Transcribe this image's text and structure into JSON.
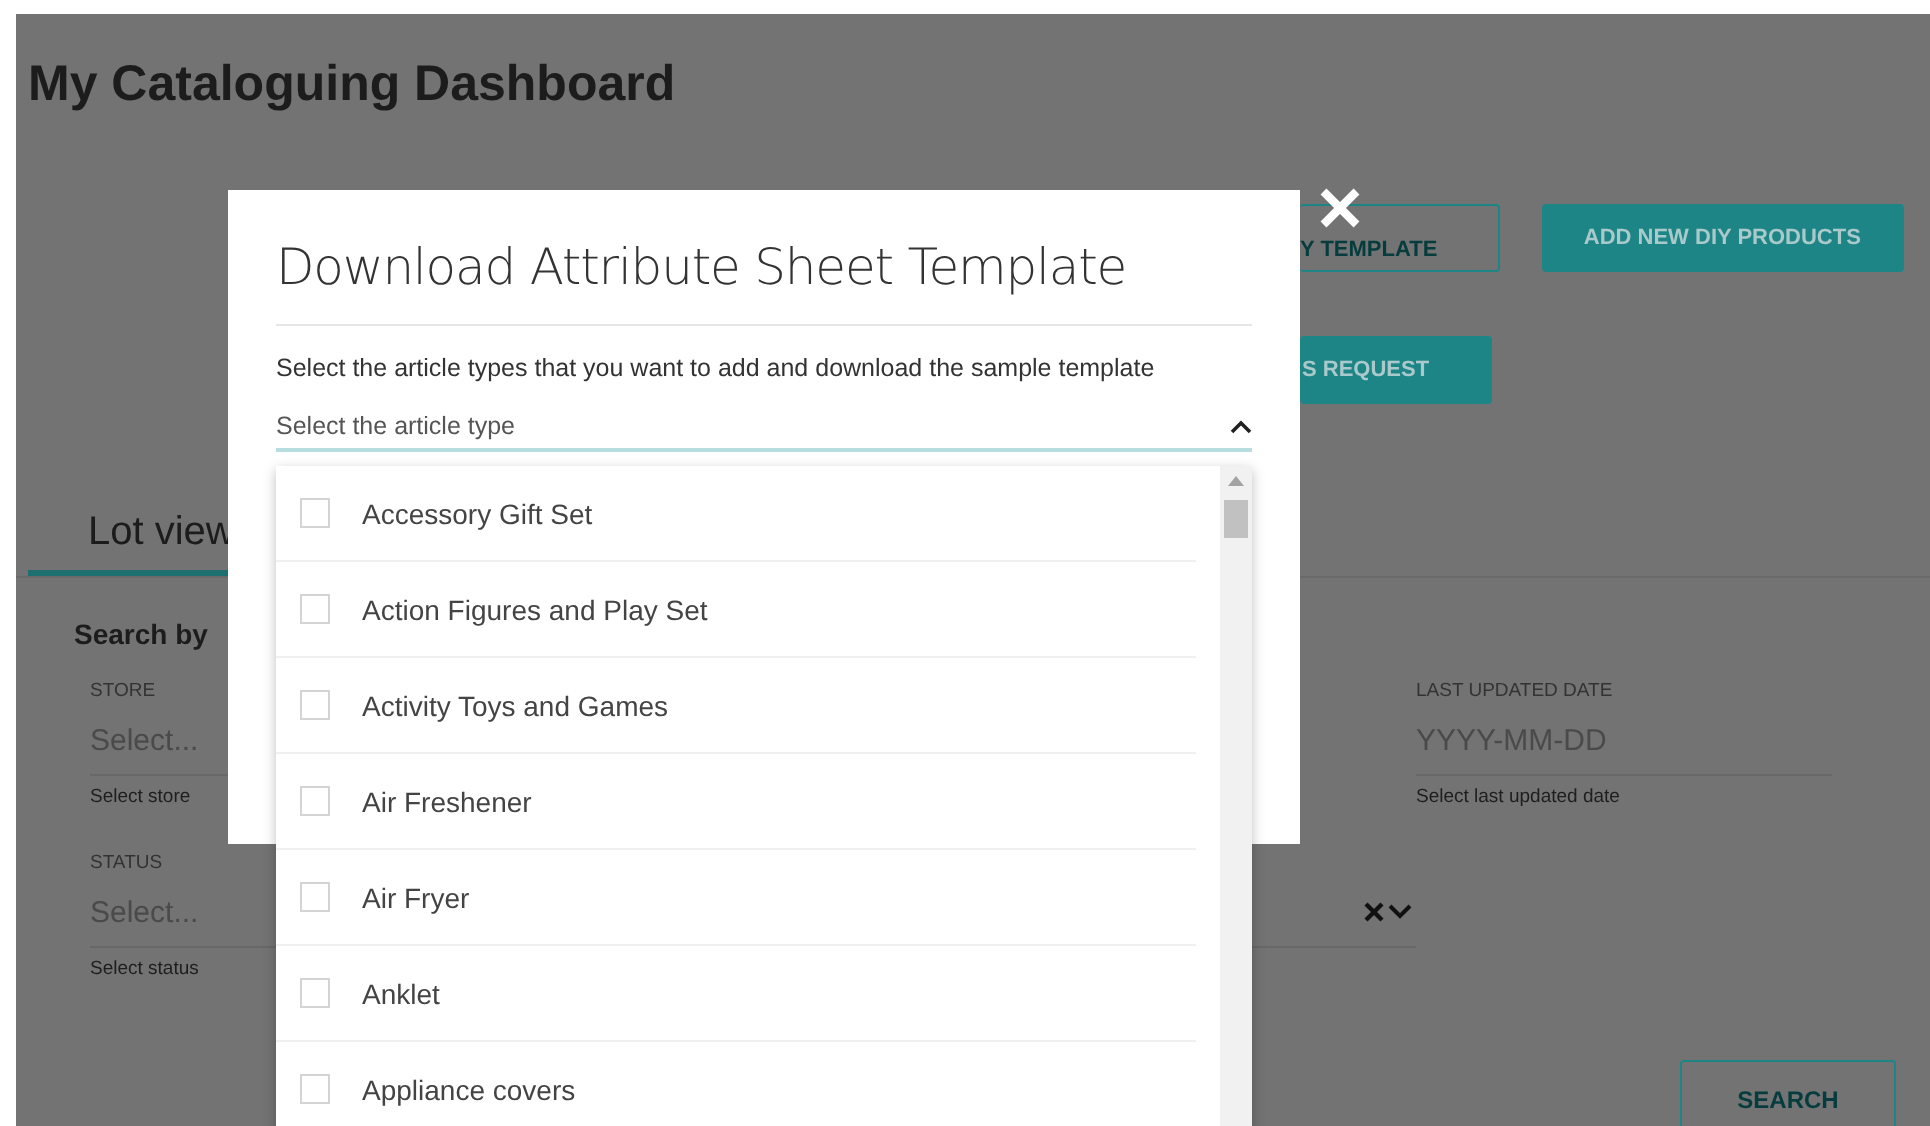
{
  "page": {
    "title": "My Cataloguing Dashboard",
    "actions": [
      [
        {
          "label": "Y TEMPLATE",
          "kind": "outline"
        },
        {
          "label": "ADD NEW DIY PRODUCTS",
          "kind": "filled"
        }
      ],
      [
        {
          "label": "S REQUEST",
          "kind": "filled"
        }
      ]
    ],
    "tabs": [
      {
        "label": "Lot view",
        "selected": true
      }
    ],
    "search": {
      "heading": "Search by",
      "fields": [
        {
          "label": "STORE",
          "placeholder": "Select...",
          "hint": "Select store"
        },
        {
          "label": "LAST UPDATED DATE",
          "placeholder": "YYYY-MM-DD",
          "hint": "Select last updated date"
        },
        {
          "label": "STATUS",
          "placeholder": "Select...",
          "hint": "Select status"
        }
      ],
      "button": "SEARCH"
    }
  },
  "modal": {
    "title": "Download Attribute Sheet Template",
    "description": "Select the article types that you want to add and download the sample template",
    "select": {
      "placeholder": "Select the article type",
      "expanded": true,
      "options": [
        {
          "label": "Accessory Gift Set",
          "checked": false
        },
        {
          "label": "Action Figures and Play Set",
          "checked": false
        },
        {
          "label": "Activity Toys and Games",
          "checked": false
        },
        {
          "label": "Air Freshener",
          "checked": false
        },
        {
          "label": "Air Fryer",
          "checked": false
        },
        {
          "label": "Anklet",
          "checked": false
        },
        {
          "label": "Appliance covers",
          "checked": false
        }
      ]
    }
  }
}
